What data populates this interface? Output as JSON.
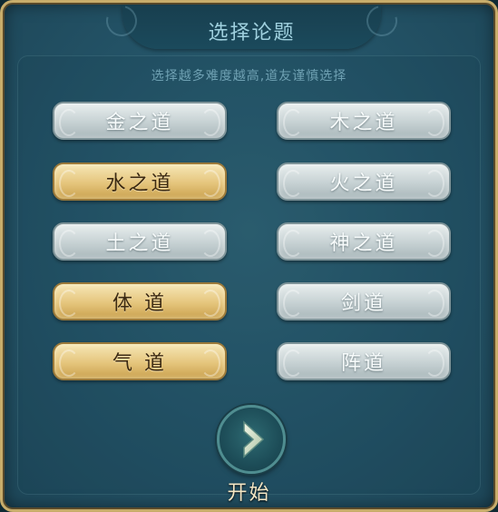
{
  "title": "选择论题",
  "subtitle": "选择越多难度越高,道友谨慎选择",
  "topics": {
    "metal": {
      "label": "金之道",
      "selected": false
    },
    "wood": {
      "label": "木之道",
      "selected": false
    },
    "water": {
      "label": "水之道",
      "selected": true
    },
    "fire": {
      "label": "火之道",
      "selected": false
    },
    "earth": {
      "label": "土之道",
      "selected": false
    },
    "spirit": {
      "label": "神之道",
      "selected": false
    },
    "body": {
      "label": "体 道",
      "selected": true
    },
    "sword": {
      "label": "剑道",
      "selected": false
    },
    "qi": {
      "label": "气 道",
      "selected": true
    },
    "formation": {
      "label": "阵道",
      "selected": false
    }
  },
  "start": {
    "label": "开始",
    "icon": "play-arrow-icon"
  },
  "colors": {
    "panel_bg": "#25566a",
    "border_gold": "#c8ad6b",
    "selected_gold": "#e5c57c",
    "unselected_silver": "#c6d1d3",
    "title_text": "#9fd0de"
  }
}
